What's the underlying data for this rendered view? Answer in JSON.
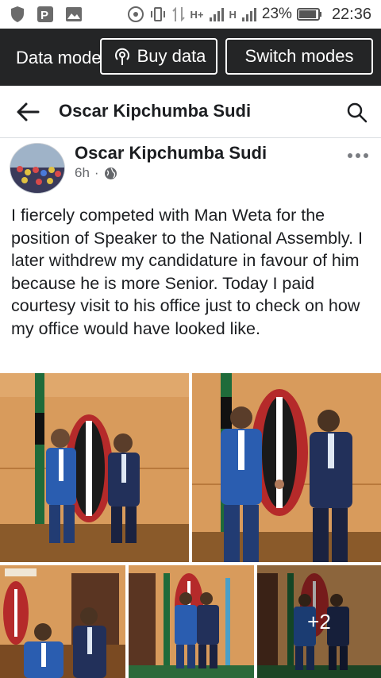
{
  "status_bar": {
    "battery_percent": "23%",
    "time": "22:36",
    "network_1": "H+",
    "network_2": "H",
    "signal_icon": "signal-icon",
    "battery_level": 0.23
  },
  "banner": {
    "title": "Data mode",
    "buy_label": "Buy data",
    "switch_label": "Switch modes"
  },
  "header": {
    "title": "Oscar Kipchumba Sudi"
  },
  "post": {
    "author": "Oscar Kipchumba Sudi",
    "time": "6h",
    "separator": "·",
    "privacy_icon": "globe-icon",
    "text": "I fiercely competed with Man Weta for the position of Speaker to the National Assembly. I later withdrew my candidature in favour of him because he is more Senior. Today I paid courtesy visit to his office just to check on how my office would have looked like.",
    "more_photos": "+2"
  },
  "colors": {
    "banner_bg": "#242526",
    "text": "#1c1e21",
    "muted": "#65676b"
  }
}
